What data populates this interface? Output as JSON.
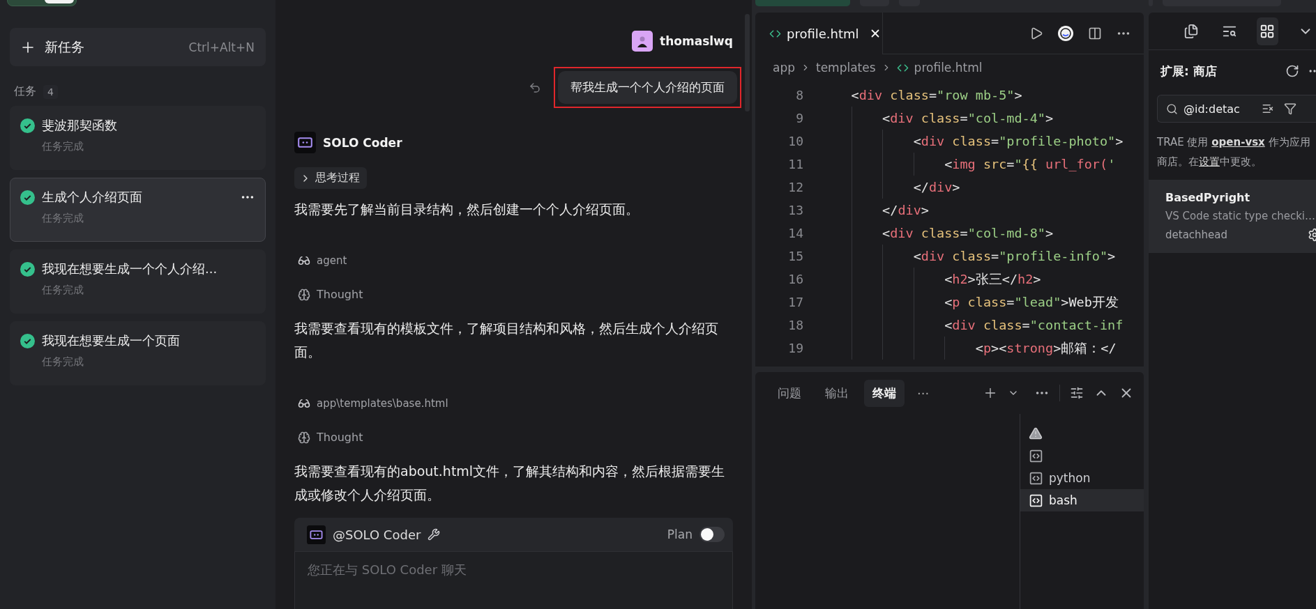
{
  "sidebar": {
    "new_task": {
      "label": "新任务",
      "shortcut": "Ctrl+Alt+N"
    },
    "section": {
      "title": "任务",
      "count": "4"
    },
    "tasks": [
      {
        "title": "斐波那契函数",
        "status": "任务完成",
        "selected": false
      },
      {
        "title": "生成个人介绍页面",
        "status": "任务完成",
        "selected": true
      },
      {
        "title": "我现在想要生成一个个人介绍...",
        "status": "任务完成",
        "selected": false
      },
      {
        "title": "我现在想要生成一个页面",
        "status": "任务完成",
        "selected": false
      }
    ]
  },
  "chat": {
    "user": {
      "name": "thomaslwq"
    },
    "user_message": {
      "text": "帮我生成一个个人介绍的页面",
      "highlighted": true
    },
    "agent": {
      "name": "SOLO Coder"
    },
    "steps": [
      {
        "kind": "disclosure",
        "label": "思考过程",
        "expanded": false
      },
      {
        "kind": "paragraph",
        "text": "我需要先了解当前目录结构，然后创建一个个人介绍页面。"
      },
      {
        "kind": "tool",
        "label": "agent"
      },
      {
        "kind": "thought",
        "label": "Thought"
      },
      {
        "kind": "paragraph",
        "text": "我需要查看现有的模板文件，了解项目结构和风格，然后生成个人介绍页面。"
      },
      {
        "kind": "tool",
        "label": "app\\templates\\base.html"
      },
      {
        "kind": "thought",
        "label": "Thought"
      },
      {
        "kind": "paragraph",
        "text": "我需要查看现有的about.html文件，了解其结构和内容，然后根据需要生成或修改个人介绍页面。"
      }
    ],
    "composer": {
      "mention": "@SOLO Coder",
      "plan_label": "Plan",
      "plan_on": false,
      "placeholder": "您正在与 SOLO Coder 聊天"
    }
  },
  "editor": {
    "tabs": [
      {
        "label": "profile.html",
        "selected": true
      }
    ],
    "breadcrumb": [
      "app",
      "templates",
      "profile.html"
    ],
    "lines": [
      {
        "number": "8",
        "tokens": [
          {
            "kind": "punct",
            "text": "    <"
          },
          {
            "kind": "tag",
            "text": "div"
          },
          {
            "kind": "attr",
            "text": " class"
          },
          {
            "kind": "punct",
            "text": "="
          },
          {
            "kind": "str",
            "text": "\"row mb-5\""
          },
          {
            "kind": "punct",
            "text": ">"
          }
        ]
      },
      {
        "number": "9",
        "tokens": [
          {
            "kind": "punct",
            "text": "        <"
          },
          {
            "kind": "tag",
            "text": "div"
          },
          {
            "kind": "attr",
            "text": " class"
          },
          {
            "kind": "punct",
            "text": "="
          },
          {
            "kind": "str",
            "text": "\"col-md-4\""
          },
          {
            "kind": "punct",
            "text": ">"
          }
        ]
      },
      {
        "number": "10",
        "tokens": [
          {
            "kind": "punct",
            "text": "            <"
          },
          {
            "kind": "tag",
            "text": "div"
          },
          {
            "kind": "attr",
            "text": " class"
          },
          {
            "kind": "punct",
            "text": "="
          },
          {
            "kind": "str",
            "text": "\"profile-photo\""
          },
          {
            "kind": "punct",
            "text": ">"
          }
        ]
      },
      {
        "number": "11",
        "tokens": [
          {
            "kind": "punct",
            "text": "                <"
          },
          {
            "kind": "tag",
            "text": "img"
          },
          {
            "kind": "attr",
            "text": " src"
          },
          {
            "kind": "punct",
            "text": "="
          },
          {
            "kind": "str",
            "text": "\""
          },
          {
            "kind": "attr",
            "text": "{{"
          },
          {
            "kind": "tag",
            "text": " url_for("
          },
          {
            "kind": "str",
            "text": "'"
          }
        ]
      },
      {
        "number": "12",
        "tokens": [
          {
            "kind": "punct",
            "text": "            </"
          },
          {
            "kind": "tag",
            "text": "div"
          },
          {
            "kind": "punct",
            "text": ">"
          }
        ]
      },
      {
        "number": "13",
        "tokens": [
          {
            "kind": "punct",
            "text": "        </"
          },
          {
            "kind": "tag",
            "text": "div"
          },
          {
            "kind": "punct",
            "text": ">"
          }
        ]
      },
      {
        "number": "14",
        "tokens": [
          {
            "kind": "punct",
            "text": "        <"
          },
          {
            "kind": "tag",
            "text": "div"
          },
          {
            "kind": "attr",
            "text": " class"
          },
          {
            "kind": "punct",
            "text": "="
          },
          {
            "kind": "str",
            "text": "\"col-md-8\""
          },
          {
            "kind": "punct",
            "text": ">"
          }
        ]
      },
      {
        "number": "15",
        "tokens": [
          {
            "kind": "punct",
            "text": "            <"
          },
          {
            "kind": "tag",
            "text": "div"
          },
          {
            "kind": "attr",
            "text": " class"
          },
          {
            "kind": "punct",
            "text": "="
          },
          {
            "kind": "str",
            "text": "\"profile-info\""
          },
          {
            "kind": "punct",
            "text": ">"
          }
        ]
      },
      {
        "number": "16",
        "tokens": [
          {
            "kind": "punct",
            "text": "                <"
          },
          {
            "kind": "tag",
            "text": "h2"
          },
          {
            "kind": "punct",
            "text": ">"
          },
          {
            "kind": "text",
            "text": "张三"
          },
          {
            "kind": "punct",
            "text": "</"
          },
          {
            "kind": "tag",
            "text": "h2"
          },
          {
            "kind": "punct",
            "text": ">"
          }
        ]
      },
      {
        "number": "17",
        "tokens": [
          {
            "kind": "punct",
            "text": "                <"
          },
          {
            "kind": "tag",
            "text": "p"
          },
          {
            "kind": "attr",
            "text": " class"
          },
          {
            "kind": "punct",
            "text": "="
          },
          {
            "kind": "str",
            "text": "\"lead\""
          },
          {
            "kind": "punct",
            "text": ">"
          },
          {
            "kind": "text",
            "text": "Web开发"
          }
        ]
      },
      {
        "number": "18",
        "tokens": [
          {
            "kind": "punct",
            "text": "                <"
          },
          {
            "kind": "tag",
            "text": "div"
          },
          {
            "kind": "attr",
            "text": " class"
          },
          {
            "kind": "punct",
            "text": "="
          },
          {
            "kind": "str",
            "text": "\"contact-inf"
          }
        ]
      },
      {
        "number": "19",
        "tokens": [
          {
            "kind": "punct",
            "text": "                    <"
          },
          {
            "kind": "tag",
            "text": "p"
          },
          {
            "kind": "punct",
            "text": "><"
          },
          {
            "kind": "tag",
            "text": "strong"
          },
          {
            "kind": "punct",
            "text": ">"
          },
          {
            "kind": "text",
            "text": "邮箱："
          },
          {
            "kind": "punct",
            "text": "</"
          }
        ]
      }
    ]
  },
  "panel": {
    "tabs": [
      {
        "label": "问题",
        "selected": false
      },
      {
        "label": "输出",
        "selected": false
      },
      {
        "label": "终端",
        "selected": true
      }
    ],
    "overflow": "···",
    "terminals": [
      {
        "kind": "warning",
        "selected": false
      },
      {
        "kind": "shell",
        "selected": false
      },
      {
        "kind": "shell",
        "label": "python",
        "selected": false
      },
      {
        "kind": "shell",
        "label": "bash",
        "selected": true
      }
    ]
  },
  "extensions": {
    "title": "扩展: 商店",
    "search": "@id:detac",
    "notice": [
      {
        "kind": "text",
        "text": "TRAE 使用 "
      },
      {
        "kind": "link",
        "text": "open-vsx",
        "bold": true
      },
      {
        "kind": "text",
        "text": " 作为应用商店。在"
      },
      {
        "kind": "link",
        "text": "设置",
        "bold": false
      },
      {
        "kind": "text",
        "text": "中更改。"
      }
    ],
    "items": [
      {
        "name": "BasedPyright",
        "description": "VS Code static type checki…",
        "publisher": "detachhead"
      }
    ]
  }
}
